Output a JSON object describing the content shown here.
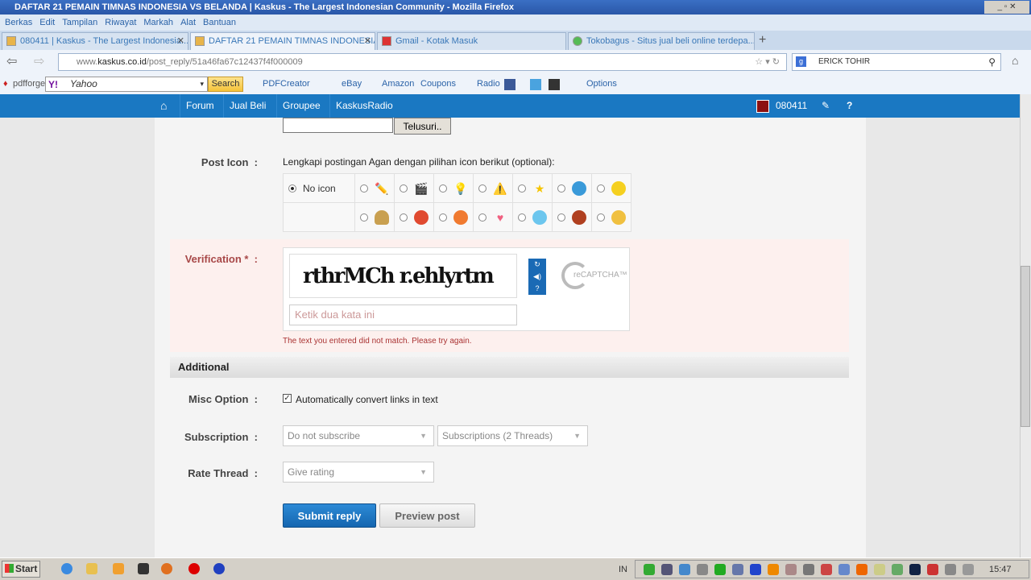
{
  "window": {
    "title": "DAFTAR 21 PEMAIN TIMNAS INDONESIA VS BELANDA | Kaskus - The Largest Indonesian Community - Mozilla Firefox"
  },
  "menu": [
    "Berkas",
    "Edit",
    "Tampilan",
    "Riwayat",
    "Markah",
    "Alat",
    "Bantuan"
  ],
  "tabs": [
    {
      "label": "080411 | Kaskus - The Largest Indonesia..."
    },
    {
      "label": "DAFTAR 21 PEMAIN TIMNAS INDONESIA..."
    },
    {
      "label": "Gmail - Kotak Masuk"
    },
    {
      "label": "Tokobagus - Situs jual beli online terdepa..."
    }
  ],
  "url": {
    "host_prefix": "www.",
    "host": "kaskus.co.id",
    "path": "/post_reply/51a46fa67c12437f4f000009"
  },
  "search_engine": {
    "value": "ERICK TOHIR"
  },
  "toolbar": {
    "pdfforge": "pdfforge",
    "yahoo": "Yahoo",
    "search": "Search",
    "pdfcreator": "PDFCreator",
    "ebay": "eBay",
    "amazon": "Amazon",
    "coupons": "Coupons",
    "radio": "Radio",
    "options": "Options"
  },
  "kaskus_nav": {
    "items": [
      "Forum",
      "Jual Beli",
      "Groupee",
      "KaskusRadio"
    ],
    "user": "080411"
  },
  "form": {
    "browse_button": "Telusuri..",
    "post_icon_label": "Post Icon",
    "post_icon_hint": "Lengkapi postingan Agan dengan pilihan icon berikut (optional):",
    "no_icon": "No icon",
    "icons_row1": [
      "pencil-icon",
      "clapper-icon",
      "bulb-icon",
      "warning-icon",
      "star-icon",
      "cool-icon",
      "smile-icon"
    ],
    "icons_row2": [
      "poop-icon",
      "angry-icon",
      "laugh-icon",
      "heart-icon",
      "blush-icon",
      "burst-icon",
      "thumbs-icon"
    ],
    "verification_label": "Verification *",
    "captcha_input_placeholder": "Ketik dua kata ini",
    "captcha_words": "rthrMCh  r.ehlyrtm",
    "captcha_logo": "reCAPTCHA™",
    "captcha_error": "The text you entered did not match. Please try again.",
    "additional_header": "Additional",
    "misc_label": "Misc Option",
    "misc_checkbox": "Automatically convert links in text",
    "misc_checked": true,
    "subscription_label": "Subscription",
    "subscription_value": "Do not subscribe",
    "subscriptions_threads": "Subscriptions (2 Threads)",
    "rate_label": "Rate Thread",
    "rate_value": "Give rating",
    "submit": "Submit reply",
    "preview": "Preview post"
  },
  "taskbar": {
    "start": "Start",
    "lang": "IN",
    "clock": "15:47"
  },
  "colors": {
    "kaskus_blue": "#1a78c2",
    "verify_bg": "#fdf0ee",
    "error": "#a33"
  }
}
